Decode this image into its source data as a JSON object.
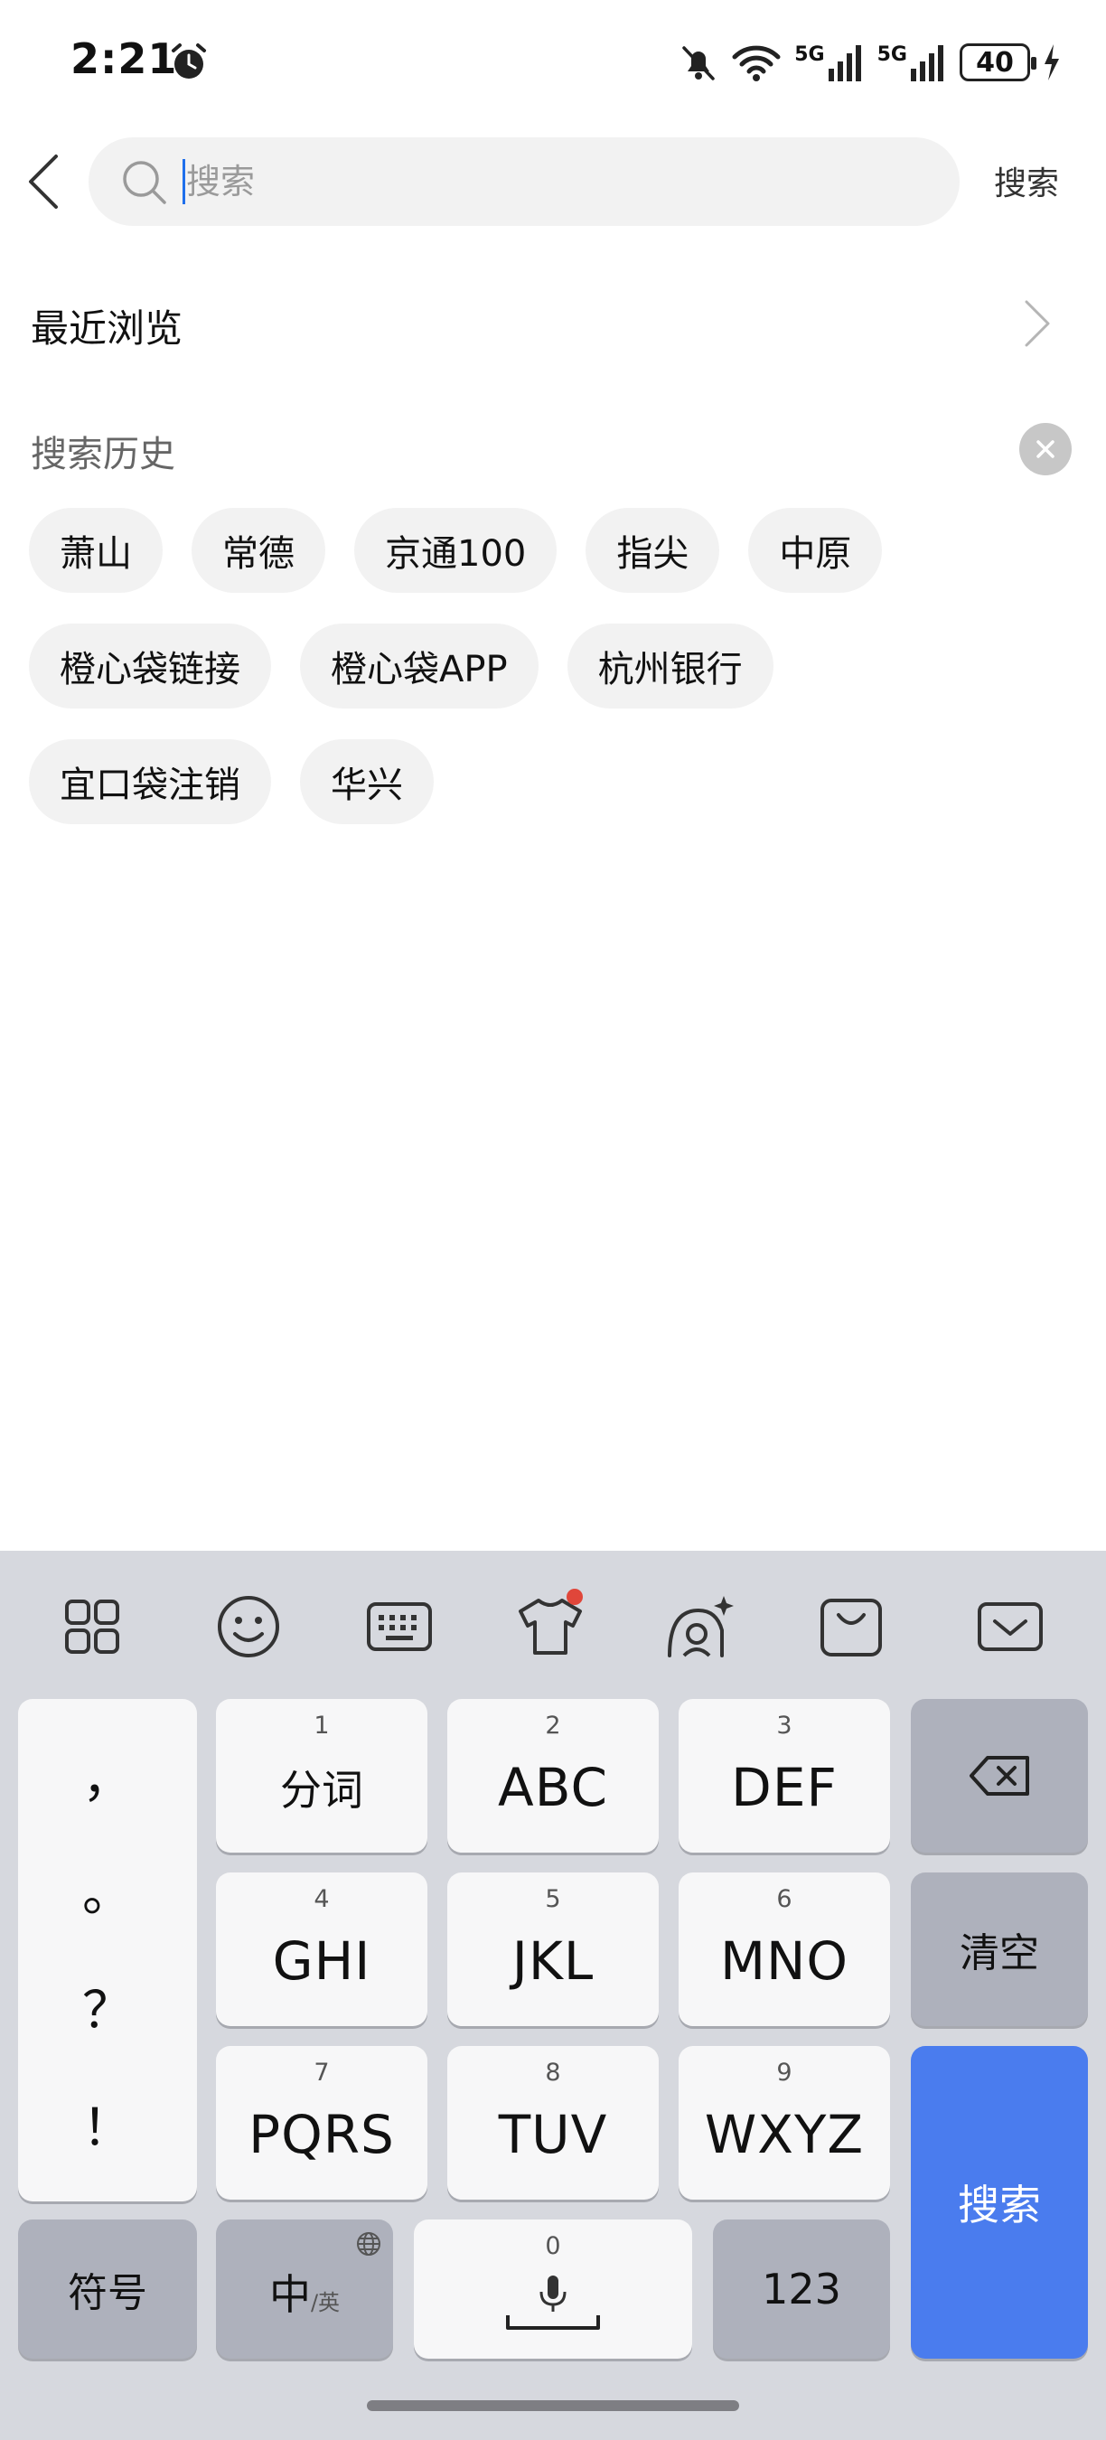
{
  "status_bar": {
    "time": "2:21",
    "network_1": "5G",
    "network_2": "5G",
    "battery": "40"
  },
  "search": {
    "placeholder": "搜索",
    "submit_label": "搜索"
  },
  "recent": {
    "title": "最近浏览"
  },
  "history": {
    "title": "搜索历史",
    "tags": [
      [
        "萧山",
        "常德",
        "京通100",
        "指尖",
        "中原"
      ],
      [
        "橙心袋链接",
        "橙心袋APP",
        "杭州银行"
      ],
      [
        "宜口袋注销",
        "华兴"
      ]
    ]
  },
  "keyboard": {
    "toolbar": [
      "apps-grid-icon",
      "emoji-icon",
      "keyboard-layout-icon",
      "theme-shirt-icon",
      "ai-avatar-icon",
      "clipboard-bag-icon",
      "collapse-keyboard-icon"
    ],
    "punctuation": [
      "，",
      "。",
      "？",
      "！"
    ],
    "keys": {
      "k1": {
        "num": "1",
        "label": "分词"
      },
      "k2": {
        "num": "2",
        "label": "ABC"
      },
      "k3": {
        "num": "3",
        "label": "DEF"
      },
      "k4": {
        "num": "4",
        "label": "GHI"
      },
      "k5": {
        "num": "5",
        "label": "JKL"
      },
      "k6": {
        "num": "6",
        "label": "MNO"
      },
      "k7": {
        "num": "7",
        "label": "PQRS"
      },
      "k8": {
        "num": "8",
        "label": "TUV"
      },
      "k9": {
        "num": "9",
        "label": "WXYZ"
      },
      "k0": {
        "num": "0"
      }
    },
    "clear_label": "清空",
    "search_label": "搜索",
    "symbols_label": "符号",
    "lang_main": "中",
    "lang_sub": "/英",
    "numbers_label": "123"
  },
  "colors": {
    "accent": "#4a7cee",
    "chip_bg": "#f2f2f2",
    "keyboard_bg": "#d6d8de"
  }
}
